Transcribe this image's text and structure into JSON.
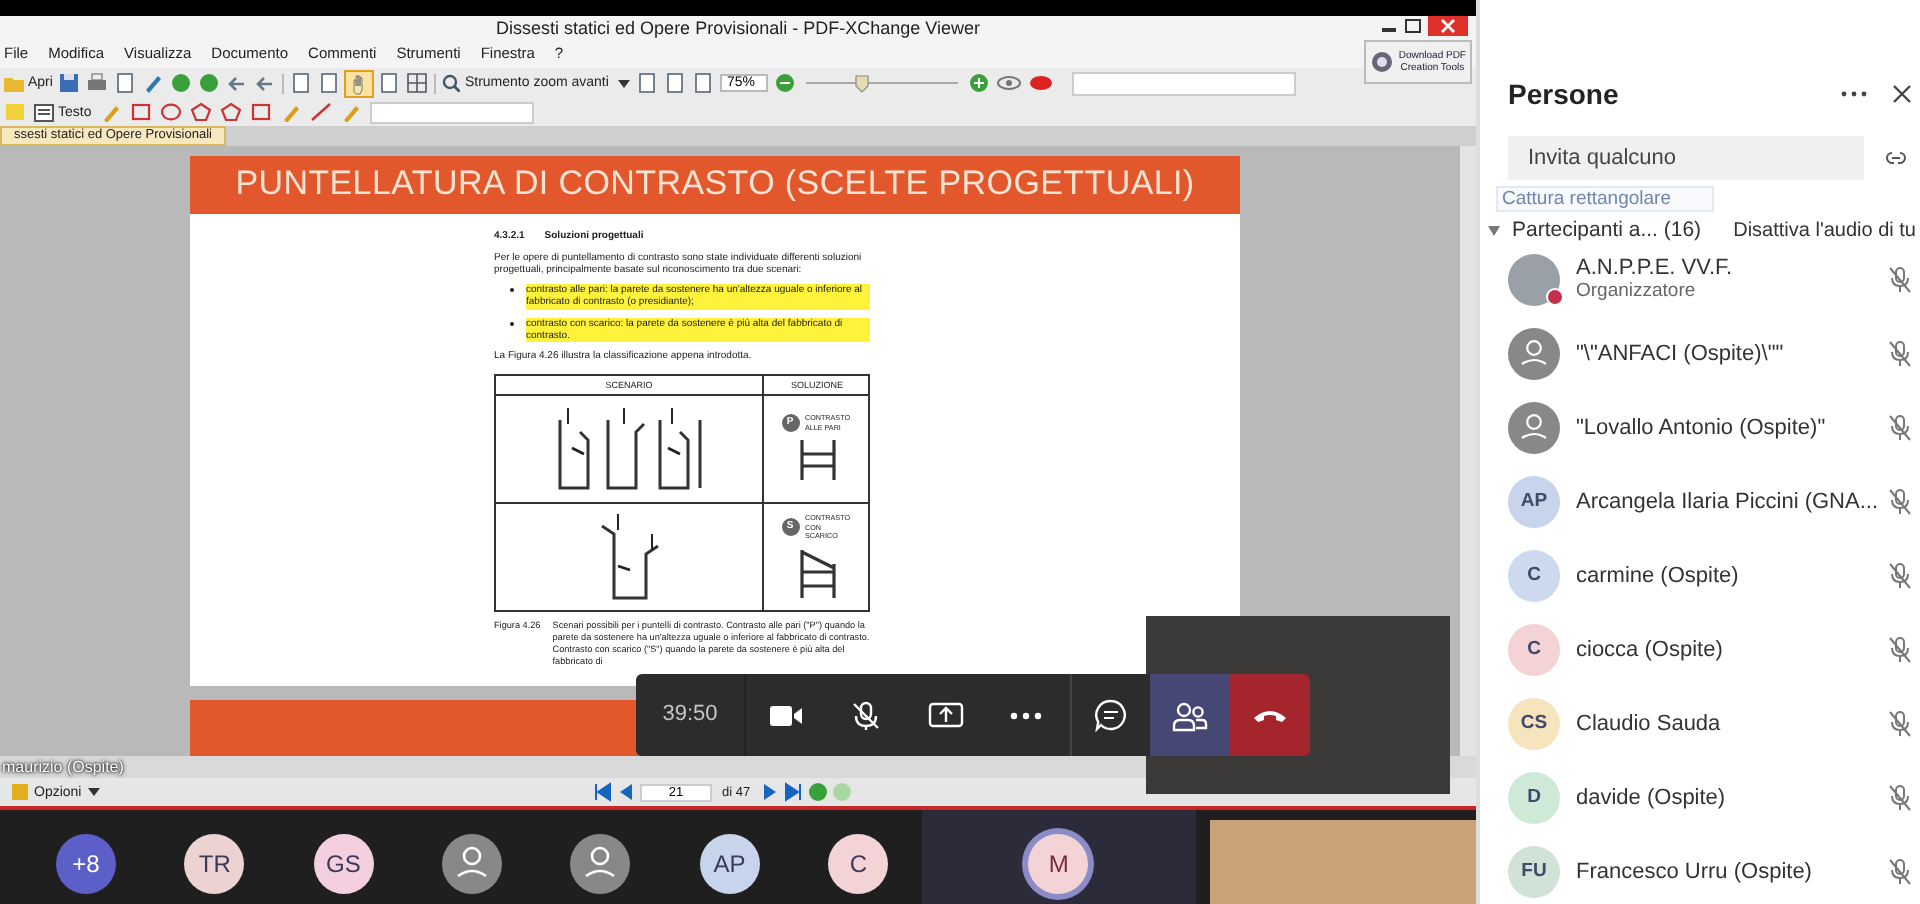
{
  "pdf_viewer": {
    "title": "Dissesti statici ed Opere Provisionali - PDF-XChange Viewer",
    "menu": [
      "File",
      "Modifica",
      "Visualizza",
      "Documento",
      "Commenti",
      "Strumenti",
      "Finestra",
      "?"
    ],
    "download_button": [
      "Download PDF",
      "Creation Tools"
    ],
    "toolbar": {
      "open": "Apri",
      "zoom_tool": "Strumento zoom avanti",
      "zoom_level": "75%",
      "text_tool": "Testo"
    },
    "tab": "ssesti statici ed Opere Provisionali",
    "slide": {
      "heading": "PUNTELLATURA DI CONTRASTO (SCELTE PROGETTUALI)",
      "section_number": "4.3.2.1",
      "section_title": "Soluzioni progettuali",
      "intro": "Per le opere di puntellamento di contrasto sono state individuate differenti soluzioni progettuali, principalmente basate sul riconoscimento tra due scenari:",
      "bullets": [
        {
          "text": "contrasto alle pari: la parete da sostenere ha un'altezza uguale o inferiore al fabbricato di contrasto (o presidiante);",
          "highlighted": true
        },
        {
          "text": "contrasto con scarico: la parete da sostenere è più alta del fabbricato di contrasto.",
          "highlighted": true
        }
      ],
      "figure_ref": "La Figura 4.26 illustra la classificazione appena introdotta.",
      "table": {
        "headers": [
          "SCENARIO",
          "SOLUZIONE"
        ],
        "rows": [
          {
            "kind": "level",
            "badge": "P",
            "label": "CONTRASTO ALLE PARI"
          },
          {
            "kind": "raked",
            "badge": "S",
            "label": "CONTRASTO CON SCARICO"
          }
        ]
      },
      "caption_label": "Figura 4.26",
      "caption": "Scenari possibili per i puntelli di contrasto. Contrasto alle pari (\"P\") quando la parete da sostenere ha un'altezza uguale o inferiore al fabbricato di contrasto. Contrasto con scarico (\"S\") quando la parete da sostenere è più alta del fabbricato di"
    },
    "status_bar": {
      "options": "Opzioni",
      "page": "21",
      "page_count": "di 47"
    }
  },
  "presenter_label": "maurizio (Ospite)",
  "call_controls": {
    "timer": "39:50",
    "buttons": [
      {
        "kind": "camera",
        "selected": false
      },
      {
        "kind": "mic-off",
        "selected": false
      },
      {
        "kind": "share",
        "selected": false
      },
      {
        "kind": "more",
        "selected": false
      },
      {
        "kind": "chat",
        "selected": false
      },
      {
        "kind": "people",
        "selected": true
      },
      {
        "kind": "hangup",
        "selected": false
      }
    ]
  },
  "gallery": [
    {
      "kind": "initials",
      "initials": "+8",
      "color": "#5b5fc7"
    },
    {
      "kind": "initials",
      "initials": "TR",
      "color": "#edd2d2"
    },
    {
      "kind": "initials",
      "initials": "GS",
      "color": "#f4cfe0"
    },
    {
      "kind": "silhouette"
    },
    {
      "kind": "silhouette"
    },
    {
      "kind": "initials",
      "initials": "AP",
      "color": "#c7d4ec"
    },
    {
      "kind": "initials",
      "initials": "C",
      "color": "#f4d3d6"
    },
    {
      "kind": "tile",
      "initials": "M",
      "color": "#f4d3d6"
    },
    {
      "kind": "video"
    }
  ],
  "people_panel": {
    "title": "Persone",
    "invite_placeholder": "Invita qualcuno",
    "tooltip": "Cattura rettangolare",
    "section": {
      "label": "Partecipanti a... (16)",
      "expanded": true,
      "mute_all": "Disattiva l'audio di tu"
    },
    "participants": [
      {
        "kind": "photo",
        "name": "A.N.P.P.E. VV.F.",
        "role": "Organizzatore",
        "status_badge": true,
        "muted": true
      },
      {
        "kind": "silhouette",
        "name": "\"\\\"ANFACI (Ospite)\\\"\"",
        "status_badge": false,
        "muted": true
      },
      {
        "kind": "silhouette",
        "name": "\"Lovallo Antonio (Ospite)\"",
        "status_badge": false,
        "muted": true
      },
      {
        "kind": "initials",
        "initials": "AP",
        "color": "#c7d4ec",
        "name": "Arcangela Ilaria Piccini (GNA...",
        "status_badge": false,
        "muted": true
      },
      {
        "kind": "initials",
        "initials": "C",
        "color": "#cdd9ee",
        "name": "carmine (Ospite)",
        "status_badge": false,
        "muted": true
      },
      {
        "kind": "initials",
        "initials": "C",
        "color": "#f4d3d6",
        "name": "ciocca (Ospite)",
        "status_badge": false,
        "muted": true
      },
      {
        "kind": "initials",
        "initials": "CS",
        "color": "#f6e4bd",
        "name": "Claudio Sauda",
        "status_badge": false,
        "muted": true
      },
      {
        "kind": "initials",
        "initials": "D",
        "color": "#cfe9d9",
        "name": "davide (Ospite)",
        "status_badge": false,
        "muted": true
      },
      {
        "kind": "initials",
        "initials": "FU",
        "color": "#d0e3d6",
        "name": "Francesco Urru (Ospite)",
        "status_badge": false,
        "muted": true
      }
    ]
  }
}
